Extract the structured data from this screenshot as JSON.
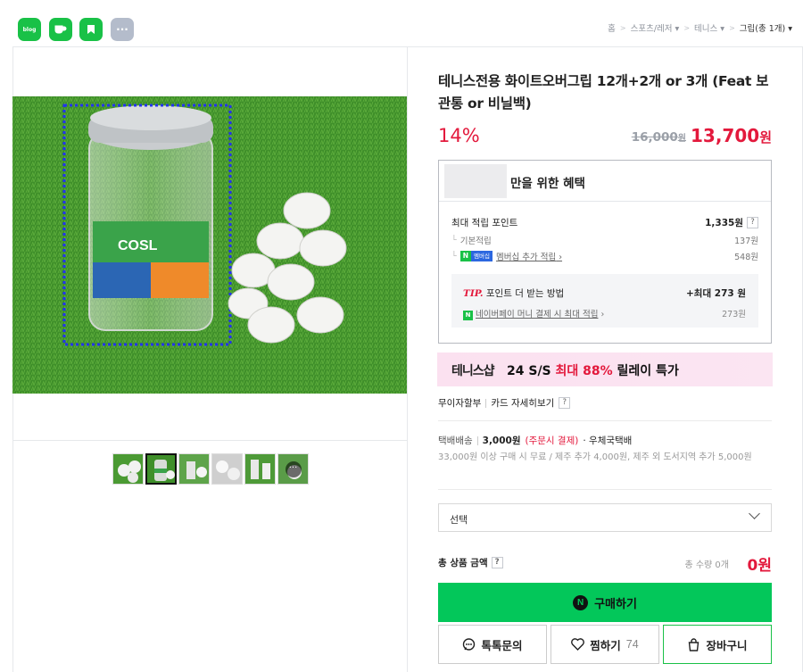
{
  "share": [
    {
      "name": "blog",
      "label": "blog"
    },
    {
      "name": "cafe",
      "label": ""
    },
    {
      "name": "bookmark",
      "label": ""
    },
    {
      "name": "more",
      "label": "···"
    }
  ],
  "breadcrumb": {
    "items": [
      "홈",
      "스포츠/레저",
      "테니스",
      "그립(총 1개)"
    ]
  },
  "product": {
    "title": "테니스전용 화이트오버그립 12개+2개 or 3개 (Feat 보관통 or 비닐백)",
    "discount": "14%",
    "original_price": "16,000",
    "original_unit": "원",
    "price": "13,700",
    "price_unit": "원"
  },
  "benefit": {
    "header": "만을 위한 혜택",
    "max_points_label": "최대 적립 포인트",
    "max_points_value": "1,335원",
    "basic_label": "기본적립",
    "basic_value": "137원",
    "n_badge": "N",
    "membership_badge": "멤버십",
    "membership_label": "멤버십 추가 적립",
    "membership_value": "548원",
    "tip_word": "TIP.",
    "tip_text": "포인트 더 받는 방법",
    "tip_max": "+최대 273 원",
    "pay_label": "네이버페이 머니 결제 시 최대 적립",
    "pay_value": "273원"
  },
  "banner": {
    "brand": "테니스샵",
    "text_main": "24 S/S ",
    "text_highlight": "최대 88%",
    "text_tail": " 릴레이 특가"
  },
  "card": {
    "installment": "무이자할부",
    "detail": "카드 자세히보기"
  },
  "shipping": {
    "method": "택배배송",
    "fee": "3,000원",
    "fee_note": "(주문시 결제)",
    "carrier": "· 우체국택배",
    "note": "33,000원 이상 구매 시 무료 / 제주 추가 4,000원, 제주 외 도서지역 추가 5,000원"
  },
  "option_select": {
    "placeholder": "선택"
  },
  "total": {
    "label": "총 상품 금액",
    "qty": "총 수량 0개",
    "amount": "0원"
  },
  "buttons": {
    "buy": "구매하기",
    "talk": "톡톡문의",
    "wish": "찜하기",
    "wish_count": "74",
    "cart": "장바구니"
  },
  "images": {
    "main_alt": "product-photo",
    "thumbnail_count": 6,
    "active_thumbnail": 2
  },
  "colors": {
    "accent_green": "#03c75a",
    "price_red": "#e3193c"
  }
}
